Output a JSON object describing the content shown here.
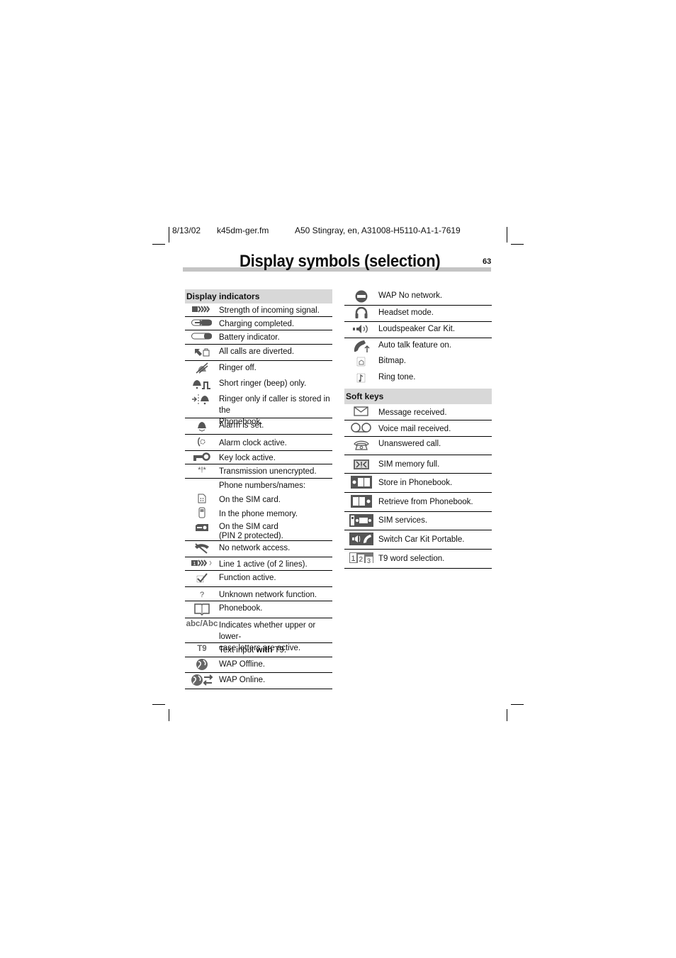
{
  "header": {
    "date": "8/13/02",
    "file": "k45dm-ger.fm",
    "doc_id": "A50 Stingray, en, A31008-H5110-A1-1-7619"
  },
  "page": {
    "title": "Display symbols (selection)",
    "number": "63"
  },
  "display_indicators": {
    "heading": "Display indicators",
    "rows": [
      {
        "icon": "signal-strength-icon",
        "text": "Strength of incoming signal."
      },
      {
        "icon": "charging-completed-icon",
        "text": "Charging completed."
      },
      {
        "icon": "battery-icon",
        "text": "Battery indicator."
      },
      {
        "icon": "calls-diverted-icon",
        "text": "All calls are diverted."
      },
      {
        "icon": "ringer-off-icon",
        "text": "Ringer off."
      },
      {
        "icon": "short-ringer-icon",
        "text": "Short ringer (beep) only."
      },
      {
        "icon": "ringer-phonebook-icon",
        "text": "Ringer only if caller is stored in the",
        "text2": "Phonebook."
      },
      {
        "icon": "alarm-bell-icon",
        "text": "Alarm is set."
      },
      {
        "icon": "alarm-clock-icon",
        "text": "Alarm clock active."
      },
      {
        "icon": "key-lock-icon",
        "text": "Key lock active."
      },
      {
        "icon": "unencrypted-icon",
        "icon_text": "*!*",
        "text": "Transmission unencrypted."
      },
      {
        "text": "Phone numbers/names:",
        "subs": [
          {
            "icon": "sim-card-icon",
            "text": "On the SIM card."
          },
          {
            "icon": "phone-memory-icon",
            "text": "In the phone memory."
          },
          {
            "icon": "sim-pin2-icon",
            "text": "On the SIM card",
            "text2": "(PIN 2 protected)."
          }
        ]
      },
      {
        "icon": "no-network-icon",
        "text": "No network access."
      },
      {
        "icon": "line1-active-icon",
        "text": "Line 1 active (of 2 lines)."
      },
      {
        "icon": "function-active-icon",
        "text": "Function active."
      },
      {
        "icon": "unknown-function-icon",
        "icon_text": "?",
        "text": "Unknown network function."
      },
      {
        "icon": "phonebook-icon",
        "text": "Phonebook."
      },
      {
        "icon": "case-icon",
        "icon_text": "abc/Abc",
        "text": "Indicates whether upper or lower-",
        "text2": "case letters are active."
      },
      {
        "icon": "t9-icon",
        "icon_text": "T9",
        "text_pre": "Text input ",
        "text_bold": "with",
        "text_post": " T9."
      },
      {
        "icon": "wap-offline-icon",
        "text": "WAP Offline."
      },
      {
        "icon": "wap-online-icon",
        "text": "WAP Online."
      }
    ]
  },
  "right_top": {
    "rows": [
      {
        "icon": "wap-no-network-icon",
        "text": "WAP No network."
      },
      {
        "icon": "headset-icon",
        "text": "Headset mode."
      },
      {
        "icon": "loudspeaker-car-kit-icon",
        "text": "Loudspeaker Car Kit."
      },
      {
        "icon": "auto-talk-icon",
        "text": "Auto talk feature on."
      },
      {
        "icon": "bitmap-icon",
        "text": "Bitmap."
      },
      {
        "icon": "ring-tone-icon",
        "text": "Ring tone."
      }
    ]
  },
  "soft_keys": {
    "heading": "Soft keys",
    "rows": [
      {
        "icon": "message-icon",
        "text": "Message received."
      },
      {
        "icon": "voicemail-icon",
        "text": "Voice mail received."
      },
      {
        "icon": "unanswered-call-icon",
        "text": "Unanswered call."
      },
      {
        "icon": "sim-memory-full-icon",
        "text": "SIM memory full."
      },
      {
        "icon": "store-phonebook-icon",
        "text": "Store in Phonebook."
      },
      {
        "icon": "retrieve-phonebook-icon",
        "text": "Retrieve from Phonebook."
      },
      {
        "icon": "sim-services-icon",
        "text": "SIM services."
      },
      {
        "icon": "switch-car-kit-icon",
        "text": "Switch Car Kit Portable."
      },
      {
        "icon": "t9-word-selection-icon",
        "text": "T9 word selection."
      }
    ]
  }
}
